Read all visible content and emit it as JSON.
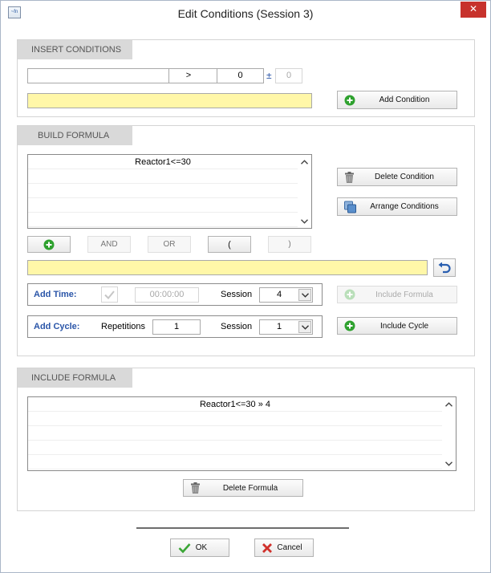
{
  "window": {
    "title": "Edit Conditions (Session 3)",
    "close_glyph": "✕",
    "app_icon": "app-icon"
  },
  "insert_conditions": {
    "header": "INSERT CONDITIONS",
    "variable_value": "",
    "operator_value": ">",
    "threshold_value": "0",
    "tolerance_symbol": "±",
    "tolerance_value": "0",
    "condition_text": "",
    "add_condition_label": "Add Condition"
  },
  "build_formula": {
    "header": "BUILD FORMULA",
    "conditions": [
      "Reactor1<=30",
      "",
      "",
      "",
      ""
    ],
    "delete_condition_label": "Delete Condition",
    "arrange_conditions_label": "Arrange Conditions",
    "logic_buttons": {
      "and": "AND",
      "or": "OR",
      "open_paren": "(",
      "close_paren": ")"
    },
    "formula_text": "",
    "add_time": {
      "label": "Add Time:",
      "time_value": "00:00:00",
      "session_label": "Session",
      "session_value": "4"
    },
    "add_cycle": {
      "label": "Add Cycle:",
      "repetitions_label": "Repetitions",
      "repetitions_value": "1",
      "session_label": "Session",
      "session_value": "1"
    },
    "include_formula_label": "Include Formula",
    "include_cycle_label": "Include Cycle"
  },
  "include_formula": {
    "header": "INCLUDE FORMULA",
    "formulas": [
      "Reactor1<=30 » 4",
      "",
      "",
      "",
      ""
    ],
    "delete_formula_label": "Delete Formula"
  },
  "footer": {
    "ok_label": "OK",
    "cancel_label": "Cancel"
  },
  "colors": {
    "accent_blue": "#2a55a8",
    "highlight_yellow": "#fff7a8",
    "close_red": "#c7322c",
    "add_green": "#2ea12e"
  }
}
